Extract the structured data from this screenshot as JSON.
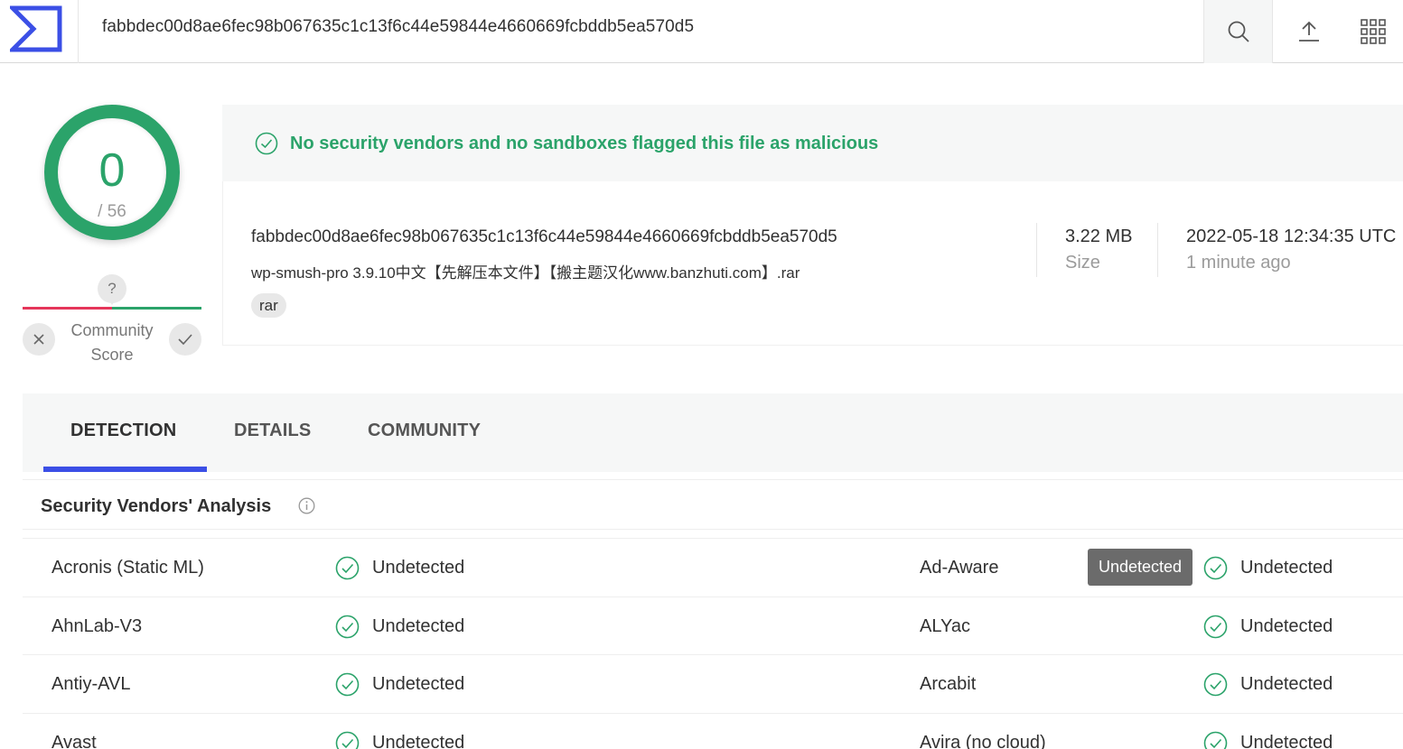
{
  "header": {
    "search_value": "fabbdec00d8ae6fec98b067635c1c13f6c44e59844e4660669fcbddb5ea570d5",
    "colors": {
      "brand": "#3b4fe6"
    }
  },
  "score": {
    "detections": "0",
    "total": "/ 56",
    "community_label_1": "Community",
    "community_label_2": "Score",
    "community_unknown": "?",
    "colors": {
      "clean": "#2ba36a",
      "malicious": "#e5365a"
    }
  },
  "banner": {
    "message": "No security vendors and no sandboxes flagged this file as malicious"
  },
  "file": {
    "hash": "fabbdec00d8ae6fec98b067635c1c13f6c44e59844e4660669fcbddb5ea570d5",
    "name": "wp-smush-pro 3.9.10中文【先解压本文件】【搬主题汉化www.banzhuti.com】.rar",
    "tag": "rar",
    "size_value": "3.22 MB",
    "size_label": "Size",
    "date_value": "2022-05-18 12:34:35 UTC",
    "date_relative": "1 minute ago"
  },
  "tabs": [
    {
      "label": "DETECTION",
      "active": true
    },
    {
      "label": "DETAILS",
      "active": false
    },
    {
      "label": "COMMUNITY",
      "active": false
    }
  ],
  "analysis": {
    "title": "Security Vendors' Analysis",
    "tooltip": "Undetected",
    "rows": [
      {
        "left_vendor": "Acronis (Static ML)",
        "left_result": "Undetected",
        "right_vendor": "Ad-Aware",
        "right_result": "Undetected"
      },
      {
        "left_vendor": "AhnLab-V3",
        "left_result": "Undetected",
        "right_vendor": "ALYac",
        "right_result": "Undetected"
      },
      {
        "left_vendor": "Antiy-AVL",
        "left_result": "Undetected",
        "right_vendor": "Arcabit",
        "right_result": "Undetected"
      },
      {
        "left_vendor": "Avast",
        "left_result": "Undetected",
        "right_vendor": "Avira (no cloud)",
        "right_result": "Undetected"
      }
    ]
  }
}
